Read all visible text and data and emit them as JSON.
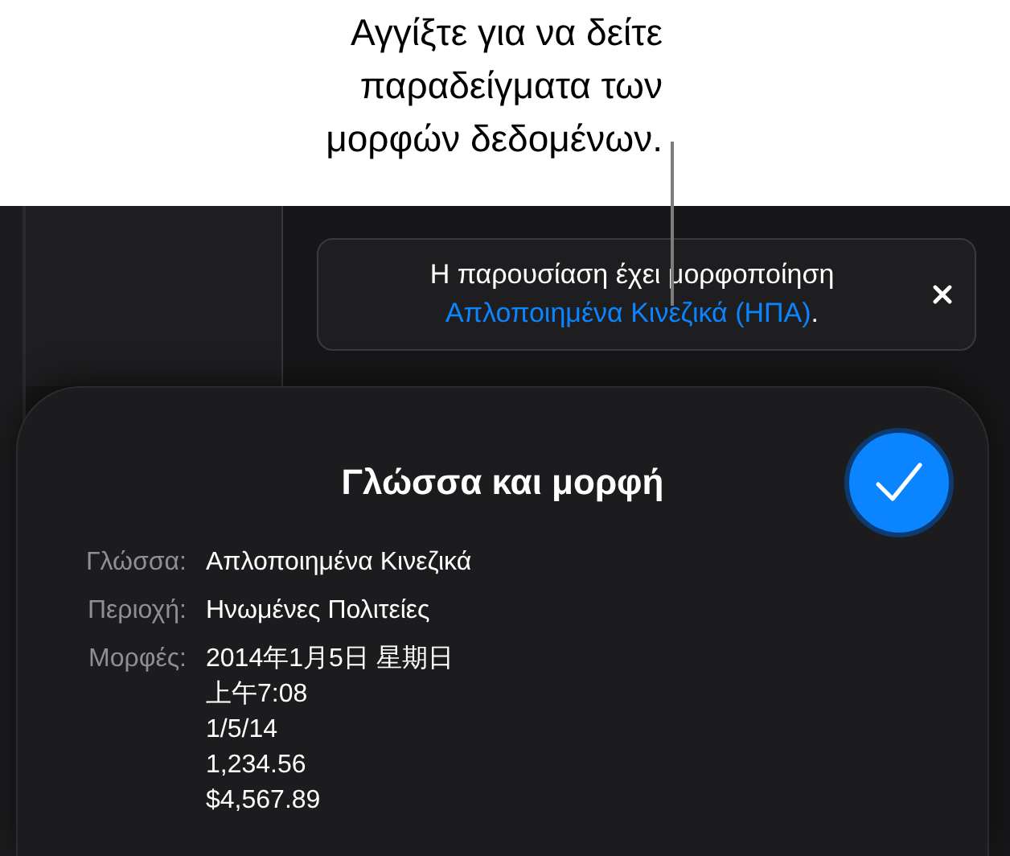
{
  "callout": {
    "text": "Αγγίξτε για να δείτε παραδείγματα των μορφών δεδομένων."
  },
  "banner": {
    "text": "Η παρουσίαση έχει μορφοποίηση",
    "link": "Απλοποιημένα Κινεζικά (ΗΠΑ)",
    "suffix": "."
  },
  "sheet": {
    "title": "Γλώσσα και μορφή",
    "fields": [
      {
        "label": "Γλώσσα:",
        "values": [
          "Απλοποιημένα Κινεζικά"
        ]
      },
      {
        "label": "Περιοχή:",
        "values": [
          "Ηνωμένες Πολιτείες"
        ]
      },
      {
        "label": "Μορφές:",
        "values": [
          "2014年1月5日 星期日",
          "上午7:08",
          "1/5/14",
          "1,234.56",
          "$4,567.89"
        ]
      }
    ]
  }
}
